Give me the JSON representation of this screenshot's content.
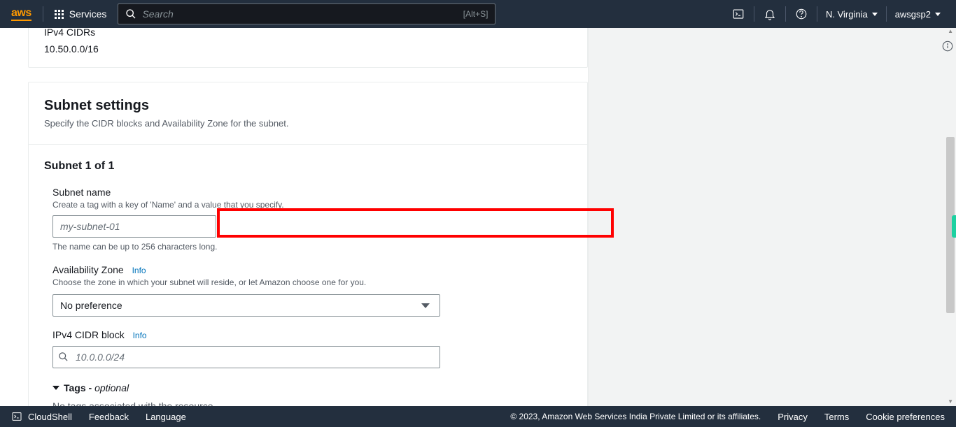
{
  "topnav": {
    "logo": "aws",
    "services": "Services",
    "search_placeholder": "Search",
    "search_shortcut": "[Alt+S]",
    "region": "N. Virginia",
    "account": "awsgsp2"
  },
  "vpc_panel": {
    "cidr_label": "IPv4 CIDRs",
    "cidr_value": "10.50.0.0/16"
  },
  "subnet_settings": {
    "title": "Subnet settings",
    "description": "Specify the CIDR blocks and Availability Zone for the subnet.",
    "counter": "Subnet 1 of 1",
    "name": {
      "label": "Subnet name",
      "help": "Create a tag with a key of 'Name' and a value that you specify.",
      "placeholder": "my-subnet-01",
      "constraint": "The name can be up to 256 characters long."
    },
    "az": {
      "label": "Availability Zone",
      "info": "Info",
      "help": "Choose the zone in which your subnet will reside, or let Amazon choose one for you.",
      "value": "No preference"
    },
    "cidr": {
      "label": "IPv4 CIDR block",
      "info": "Info",
      "placeholder": "10.0.0.0/24"
    },
    "tags": {
      "label": "Tags - ",
      "optional": "optional",
      "empty": "No tags associated with the resource."
    }
  },
  "footer": {
    "cloudshell": "CloudShell",
    "feedback": "Feedback",
    "language": "Language",
    "copyright": "© 2023, Amazon Web Services India Private Limited or its affiliates.",
    "privacy": "Privacy",
    "terms": "Terms",
    "cookie": "Cookie preferences"
  }
}
